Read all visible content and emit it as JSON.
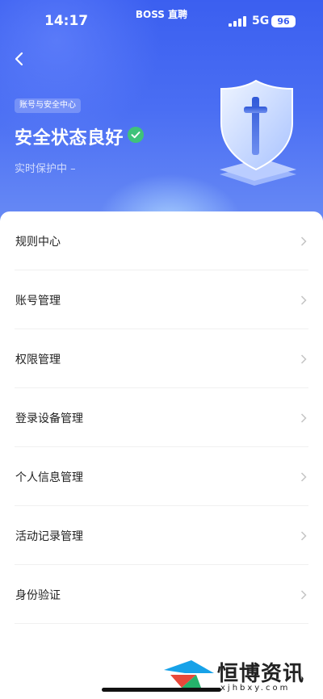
{
  "status_bar": {
    "time": "14:17",
    "app_name": "BOSS 直聘",
    "network": "5G",
    "battery": "96"
  },
  "header": {
    "tag": "账号与安全中心",
    "title": "安全状态良好",
    "subtitle": "实时保护中 –"
  },
  "menu": {
    "items": [
      {
        "label": "规则中心"
      },
      {
        "label": "账号管理"
      },
      {
        "label": "权限管理"
      },
      {
        "label": "登录设备管理"
      },
      {
        "label": "个人信息管理"
      },
      {
        "label": "活动记录管理"
      },
      {
        "label": "身份验证"
      }
    ]
  },
  "watermark": {
    "name": "恒博资讯",
    "url": "xjhbxy.com"
  },
  "colors": {
    "brand_blue": "#3b5ff0",
    "success_green": "#3fc27a"
  },
  "icons": {
    "back": "chevron-left-icon",
    "status_ok": "check-circle-icon",
    "shield": "shield-icon",
    "row_arrow": "chevron-right-icon"
  }
}
